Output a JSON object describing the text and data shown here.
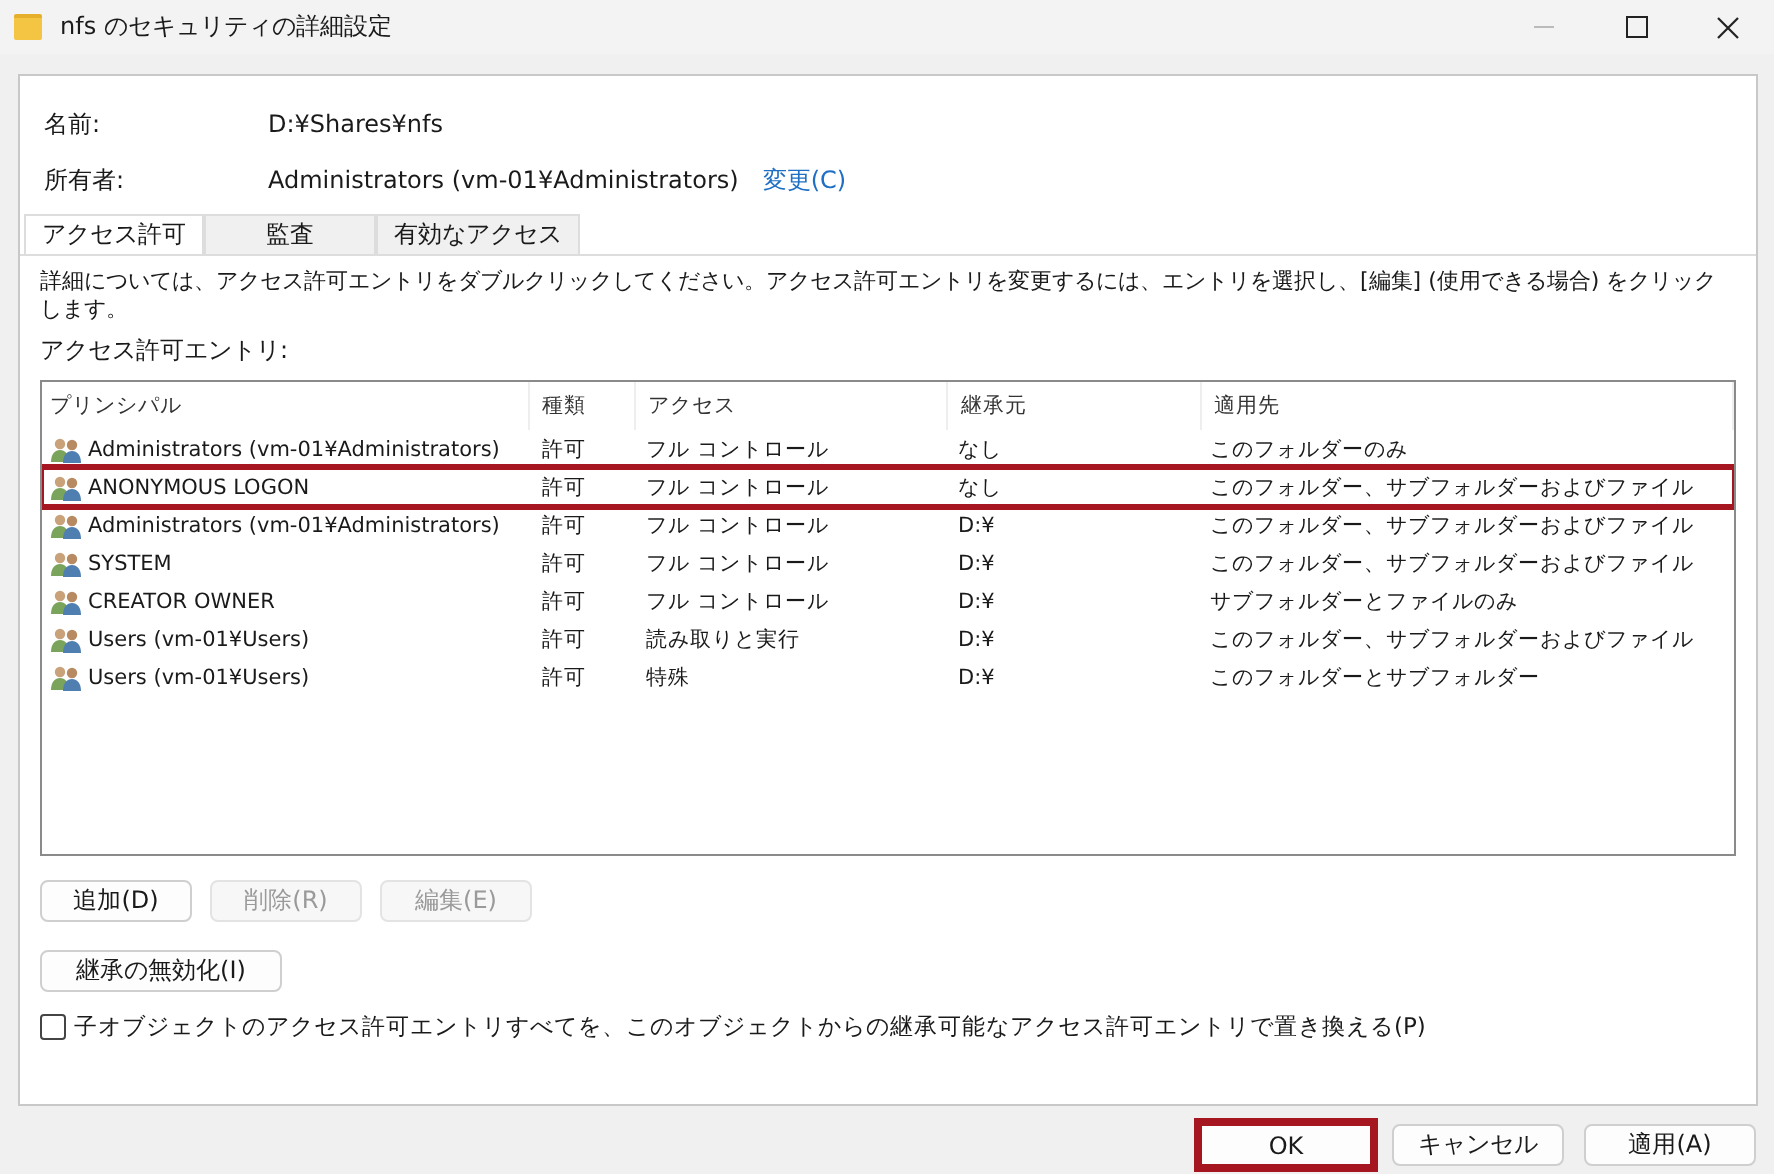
{
  "window": {
    "title": "nfs のセキュリティの詳細設定"
  },
  "fields": [
    {
      "label": "名前:",
      "value": "D:¥Shares¥nfs"
    },
    {
      "label": "所有者:",
      "value": "Administrators (vm-01¥Administrators)",
      "link": "変更(C)"
    }
  ],
  "tabs": [
    {
      "label": "アクセス許可",
      "selected": true
    },
    {
      "label": "監査",
      "selected": false
    },
    {
      "label": "有効なアクセス",
      "selected": false
    }
  ],
  "description": "詳細については、アクセス許可エントリをダブルクリックしてください。アクセス許可エントリを変更するには、エントリを選択し、[編集] (使用できる場合) をクリックします。",
  "list_label": "アクセス許可エントリ:",
  "table": {
    "columns": [
      "プリンシパル",
      "種類",
      "アクセス",
      "継承元",
      "適用先"
    ],
    "rows": [
      {
        "cells": [
          "Administrators (vm-01¥Administrators)",
          "許可",
          "フル コントロール",
          "なし",
          "このフォルダーのみ"
        ],
        "highlighted": false
      },
      {
        "cells": [
          "ANONYMOUS LOGON",
          "許可",
          "フル コントロール",
          "なし",
          "このフォルダー、サブフォルダーおよびファイル"
        ],
        "highlighted": true
      },
      {
        "cells": [
          "Administrators (vm-01¥Administrators)",
          "許可",
          "フル コントロール",
          "D:¥",
          "このフォルダー、サブフォルダーおよびファイル"
        ],
        "highlighted": false
      },
      {
        "cells": [
          "SYSTEM",
          "許可",
          "フル コントロール",
          "D:¥",
          "このフォルダー、サブフォルダーおよびファイル"
        ],
        "highlighted": false
      },
      {
        "cells": [
          "CREATOR OWNER",
          "許可",
          "フル コントロール",
          "D:¥",
          "サブフォルダーとファイルのみ"
        ],
        "highlighted": false
      },
      {
        "cells": [
          "Users (vm-01¥Users)",
          "許可",
          "読み取りと実行",
          "D:¥",
          "このフォルダー、サブフォルダーおよびファイル"
        ],
        "highlighted": false
      },
      {
        "cells": [
          "Users (vm-01¥Users)",
          "許可",
          "特殊",
          "D:¥",
          "このフォルダーとサブフォルダー"
        ],
        "highlighted": false
      }
    ]
  },
  "entry_buttons": [
    {
      "label": "追加(D)",
      "disabled": false
    },
    {
      "label": "削除(R)",
      "disabled": true
    },
    {
      "label": "編集(E)",
      "disabled": true
    }
  ],
  "inherit_button": {
    "label": "継承の無効化(I)"
  },
  "replace_checkbox": {
    "label": "子オブジェクトのアクセス許可エントリすべてを、このオブジェクトからの継承可能なアクセス許可エントリで置き換える(P)",
    "checked": false
  },
  "dialog_buttons": [
    {
      "label": "OK",
      "highlighted": true
    },
    {
      "label": "キャンセル",
      "highlighted": false
    },
    {
      "label": "適用(A)",
      "highlighted": false
    }
  ]
}
